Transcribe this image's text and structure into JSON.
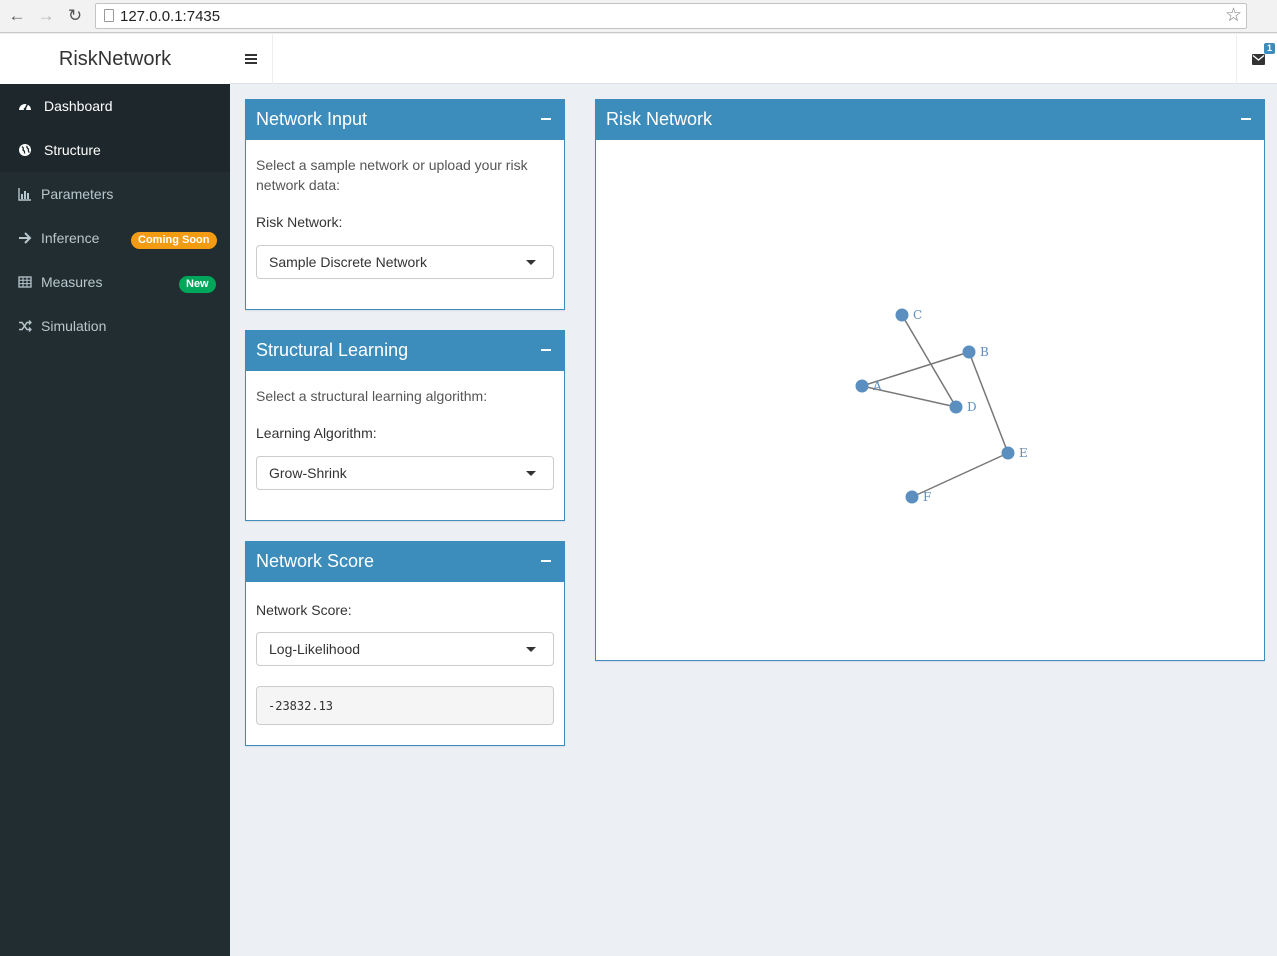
{
  "browser": {
    "url": "127.0.0.1:7435",
    "back_icon": "arrow-left-icon",
    "forward_icon": "arrow-right-icon",
    "reload_icon": "reload-icon",
    "bookmark_icon": "star-icon"
  },
  "header": {
    "app_title": "RiskNetwork",
    "toggle_icon": "hamburger-icon",
    "messages_icon": "envelope-icon",
    "messages_count": "1",
    "brand_color": "#3c8dbc"
  },
  "sidebar": {
    "items": [
      {
        "label": "Dashboard",
        "icon": "dashboard-icon",
        "active": true
      },
      {
        "label": "Structure",
        "icon": "globe-icon",
        "active": true
      },
      {
        "label": "Parameters",
        "icon": "bar-chart-icon",
        "active": false
      },
      {
        "label": "Inference",
        "icon": "arrow-right-icon",
        "active": false,
        "badge": "Coming Soon",
        "badge_color": "#f39c12"
      },
      {
        "label": "Measures",
        "icon": "table-icon",
        "active": false,
        "badge": "New",
        "badge_color": "#00a65a"
      },
      {
        "label": "Simulation",
        "icon": "random-icon",
        "active": false
      }
    ]
  },
  "network_input": {
    "title": "Network Input",
    "help": "Select a sample network or upload your risk network data:",
    "label": "Risk Network:",
    "selected": "Sample Discrete Network"
  },
  "structural_learning": {
    "title": "Structural Learning",
    "help": "Select a structural learning algorithm:",
    "label": "Learning Algorithm:",
    "selected": "Grow-Shrink"
  },
  "network_score": {
    "title": "Network Score",
    "label": "Network Score:",
    "selected": "Log-Likelihood",
    "value": "-23832.13"
  },
  "risk_network": {
    "title": "Risk Network",
    "node_color": "#5a8fc0",
    "edge_color": "#777777",
    "nodes": [
      "A",
      "B",
      "C",
      "D",
      "E",
      "F"
    ],
    "edges": [
      [
        "C",
        "D"
      ],
      [
        "A",
        "B"
      ],
      [
        "A",
        "D"
      ],
      [
        "B",
        "E"
      ],
      [
        "E",
        "F"
      ]
    ]
  }
}
